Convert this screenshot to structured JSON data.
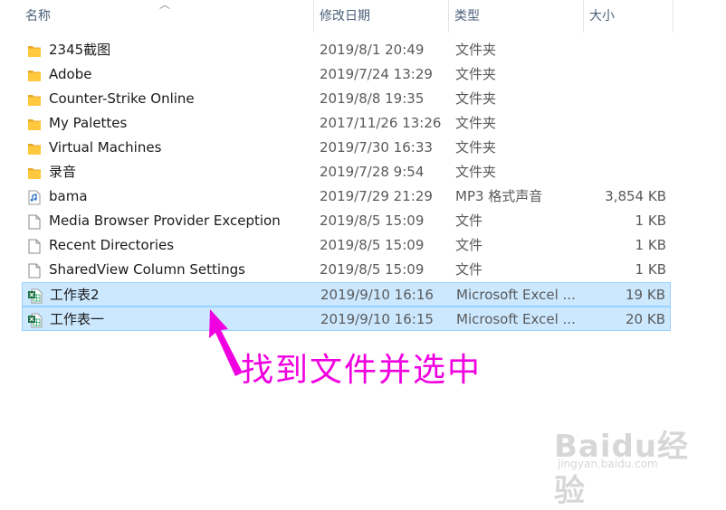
{
  "columns": {
    "name": "名称",
    "date": "修改日期",
    "type": "类型",
    "size": "大小"
  },
  "files": [
    {
      "name": "2345截图",
      "date": "2019/8/1 20:49",
      "type": "文件夹",
      "size": "",
      "icon": "folder-icon",
      "selected": false
    },
    {
      "name": "Adobe",
      "date": "2019/7/24 13:29",
      "type": "文件夹",
      "size": "",
      "icon": "folder-icon",
      "selected": false
    },
    {
      "name": "Counter-Strike Online",
      "date": "2019/8/8 19:35",
      "type": "文件夹",
      "size": "",
      "icon": "folder-icon",
      "selected": false
    },
    {
      "name": "My Palettes",
      "date": "2017/11/26 13:26",
      "type": "文件夹",
      "size": "",
      "icon": "folder-icon",
      "selected": false
    },
    {
      "name": "Virtual Machines",
      "date": "2019/7/30 16:33",
      "type": "文件夹",
      "size": "",
      "icon": "folder-icon",
      "selected": false
    },
    {
      "name": "录音",
      "date": "2019/7/28 9:54",
      "type": "文件夹",
      "size": "",
      "icon": "folder-icon",
      "selected": false
    },
    {
      "name": "bama",
      "date": "2019/7/29 21:29",
      "type": "MP3 格式声音",
      "size": "3,854 KB",
      "icon": "mp3-file-icon",
      "selected": false
    },
    {
      "name": "Media Browser Provider Exception",
      "date": "2019/8/5 15:09",
      "type": "文件",
      "size": "1 KB",
      "icon": "file-icon",
      "selected": false
    },
    {
      "name": "Recent Directories",
      "date": "2019/8/5 15:09",
      "type": "文件",
      "size": "1 KB",
      "icon": "file-icon",
      "selected": false
    },
    {
      "name": "SharedView Column Settings",
      "date": "2019/8/5 15:09",
      "type": "文件",
      "size": "1 KB",
      "icon": "file-icon",
      "selected": false
    },
    {
      "name": "工作表2",
      "date": "2019/9/10 16:16",
      "type": "Microsoft Excel ...",
      "size": "19 KB",
      "icon": "excel-file-icon",
      "selected": true
    },
    {
      "name": "工作表一",
      "date": "2019/9/10 16:15",
      "type": "Microsoft Excel ...",
      "size": "20 KB",
      "icon": "excel-file-icon",
      "selected": true
    }
  ],
  "annotation": {
    "text": "找到文件并选中",
    "color": "#f000e0"
  },
  "watermark": {
    "logo": "Baidu经验",
    "url": "jingyan.baidu.com"
  },
  "colors": {
    "selection_bg": "#cce8ff",
    "selection_border": "#99d1ff",
    "folder": "#ffc83d"
  }
}
